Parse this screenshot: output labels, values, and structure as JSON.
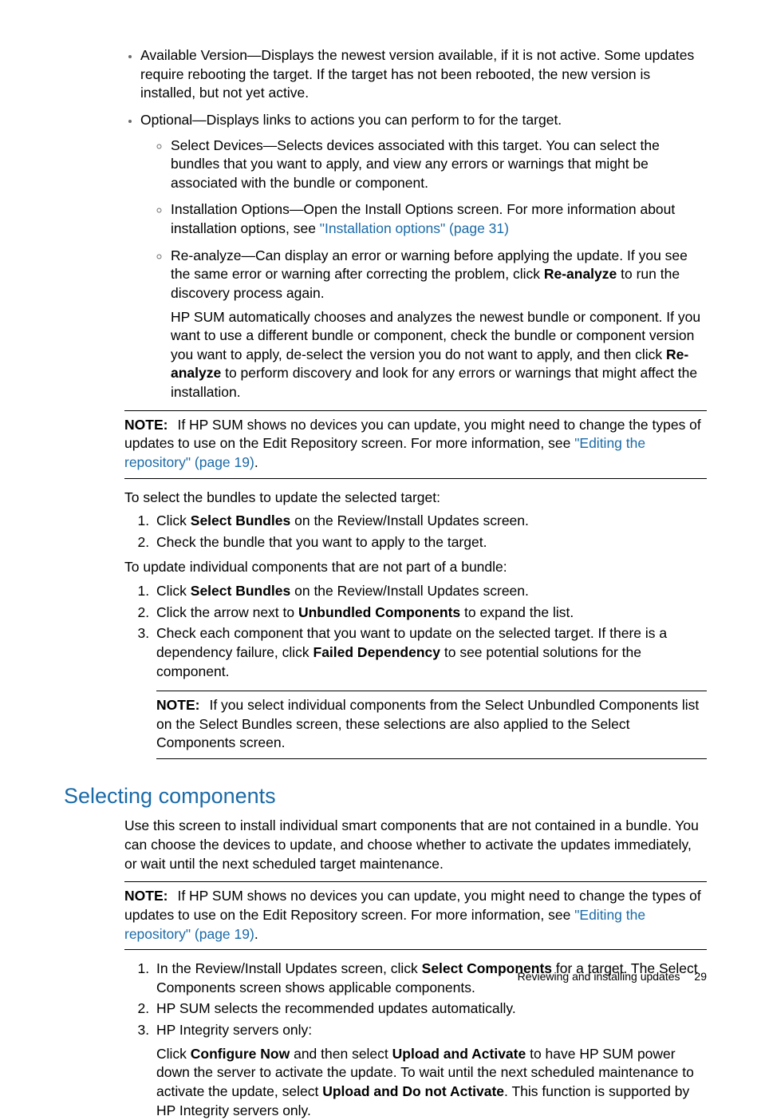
{
  "bullets": {
    "availableVersion": "Available Version—Displays the newest version available, if it is not active. Some updates require rebooting the target. If the target has not been rebooted, the new version is installed, but not yet active.",
    "optional": "Optional—Displays links to actions you can perform to for the target.",
    "selectDevices": "Select Devices—Selects devices associated with this target. You can select the bundles that you want to apply, and view any errors or warnings that might be associated with the bundle or component.",
    "installOptions_pre": "Installation Options—Open the Install Options screen. For more information about installation options, see ",
    "installOptions_link": "\"Installation options\" (page 31)",
    "reanalyze_p1_pre": "Re-analyze—Can display an error or warning before applying the update. If you see the same error or warning after correcting the problem, click ",
    "reanalyze_bold1": "Re-analyze",
    "reanalyze_p1_post": " to run the discovery process again.",
    "reanalyze_p2_pre": "HP SUM automatically chooses and analyzes the newest bundle or component. If you want to use a different bundle or component, check the bundle or component version you want to apply, de-select the version you do not want to apply, and then click ",
    "reanalyze_bold2": "Re-analyze",
    "reanalyze_p2_post": " to perform discovery and look for any errors or warnings that might affect the installation."
  },
  "notes": {
    "label": "NOTE:",
    "n1_pre": "If HP SUM shows no devices you can update, you might need to change the types of updates to use on the Edit Repository screen. For more information, see ",
    "n1_link": "\"Editing the repository\" (page 19)",
    "n1_post": ".",
    "n2": "If you select individual components from the Select Unbundled Components list on the Select Bundles screen, these selections are also applied to the Select Components screen.",
    "n3_pre": "If HP SUM shows no devices you can update, you might need to change the types of updates to use on the Edit Repository screen. For more information, see ",
    "n3_link": "\"Editing the repository\" (page 19)",
    "n3_post": "."
  },
  "paras": {
    "selectBundlesIntro": "To select the bundles to update the selected target:",
    "updateIndividualIntro": "To update individual components that are not part of a bundle:",
    "selectingComponentsPara": "Use this screen to install individual smart components that are not contained in a bundle. You can choose the devices to update, and choose whether to activate the updates immediately, or wait until the next scheduled target maintenance."
  },
  "listA": {
    "i1_pre": "Click ",
    "i1_bold": "Select Bundles",
    "i1_post": " on the Review/Install Updates screen.",
    "i2": "Check the bundle that you want to apply to the target."
  },
  "listB": {
    "i1_pre": "Click ",
    "i1_bold": "Select Bundles",
    "i1_post": " on the Review/Install Updates screen.",
    "i2_pre": "Click the arrow next to ",
    "i2_bold": "Unbundled Components",
    "i2_post": " to expand the list.",
    "i3_pre": "Check each component that you want to update on the selected target. If there is a dependency failure, click ",
    "i3_bold": "Failed Dependency",
    "i3_post": " to see potential solutions for the component."
  },
  "heading": "Selecting components",
  "listC": {
    "i1_pre": "In the Review/Install Updates screen, click ",
    "i1_bold": "Select Components",
    "i1_post": " for a target. The Select Components screen shows applicable components.",
    "i2": "HP SUM selects the recommended updates automatically.",
    "i3": "HP Integrity servers only:",
    "i3b_pre": "Click ",
    "i3b_b1": "Configure Now",
    "i3b_mid1": " and then select ",
    "i3b_b2": "Upload and Activate",
    "i3b_mid2": " to have HP SUM power down the server to activate the update. To wait until the next scheduled maintenance to activate the update, select ",
    "i3b_b3": "Upload and Do not Activate",
    "i3b_post": ". This function is supported by HP Integrity servers only."
  },
  "footer": {
    "text": "Reviewing and installing updates",
    "page": "29"
  }
}
